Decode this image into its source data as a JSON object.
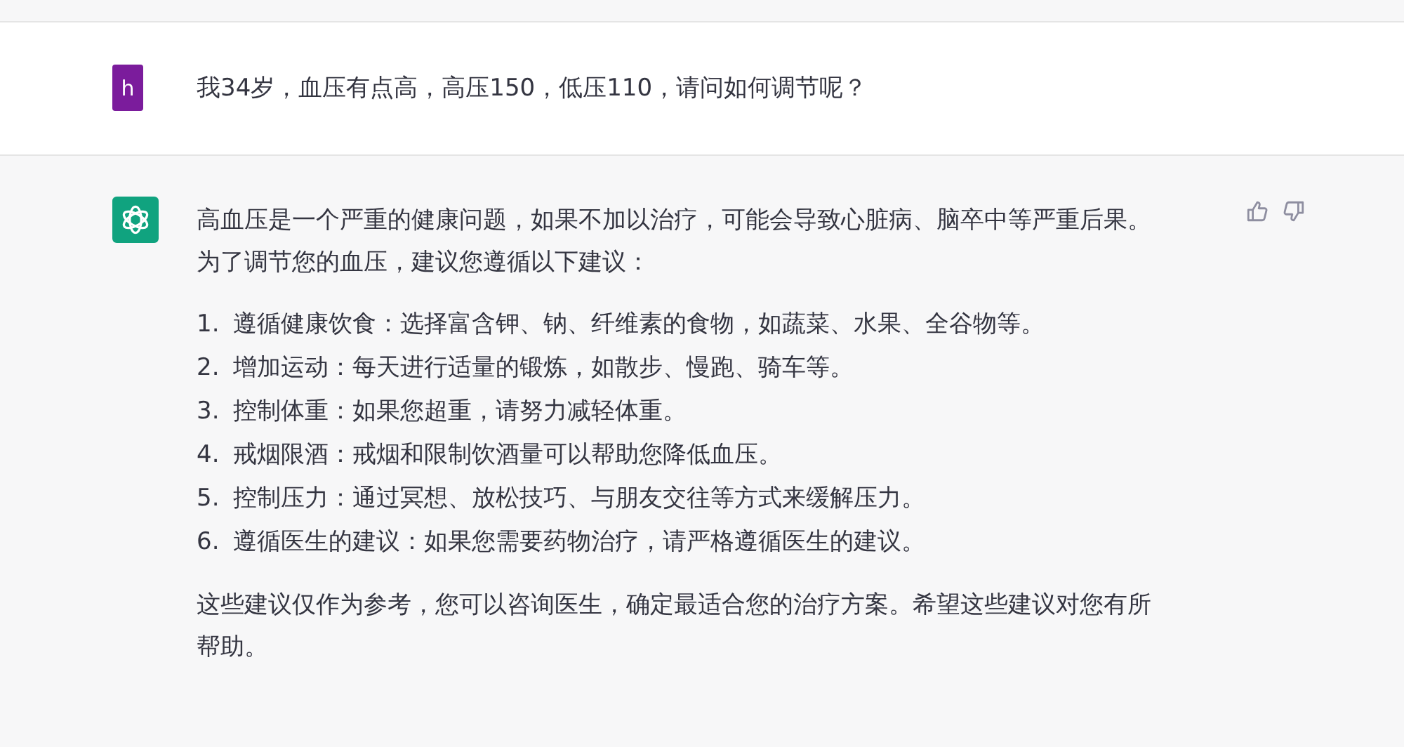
{
  "user_message": {
    "avatar": "h",
    "text": "我34岁，血压有点高，高压150，低压110，请问如何调节呢？"
  },
  "assistant_message": {
    "intro": "高血压是一个严重的健康问题，如果不加以治疗，可能会导致心脏病、脑卒中等严重后果。为了调节您的血压，建议您遵循以下建议：",
    "items": [
      {
        "number": "1.",
        "text": "遵循健康饮食：选择富含钾、钠、纤维素的食物，如蔬菜、水果、全谷物等。"
      },
      {
        "number": "2.",
        "text": "增加运动：每天进行适量的锻炼，如散步、慢跑、骑车等。"
      },
      {
        "number": "3.",
        "text": "控制体重：如果您超重，请努力减轻体重。"
      },
      {
        "number": "4.",
        "text": "戒烟限酒：戒烟和限制饮酒量可以帮助您降低血压。"
      },
      {
        "number": "5.",
        "text": "控制压力：通过冥想、放松技巧、与朋友交往等方式来缓解压力。"
      },
      {
        "number": "6.",
        "text": "遵循医生的建议：如果您需要药物治疗，请严格遵循医生的建议。"
      }
    ],
    "closing": "这些建议仅作为参考，您可以咨询医生，确定最适合您的治疗方案。希望这些建议对您有所帮助。"
  }
}
